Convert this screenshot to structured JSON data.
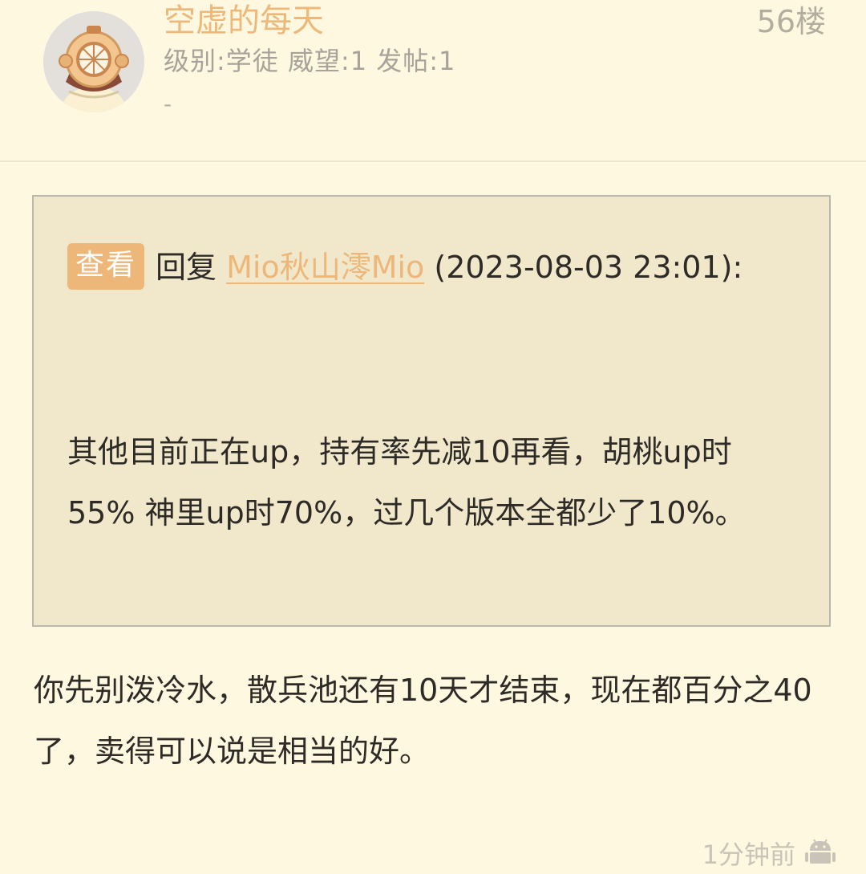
{
  "author": {
    "name": "空虚的每天",
    "meta": "级别:学徒 威望:1 发帖:1",
    "signature": "-",
    "avatar_icon": "diving-helmet-avatar"
  },
  "floor": "56楼",
  "quote": {
    "view_label": "查看",
    "reply_label": "回复",
    "quoted_user": "Mio秋山澪Mio",
    "timestamp": "(2023-08-03 23:01):",
    "text": "其他目前正在up，持有率先减10再看，胡桃up时55% 神里up时70%，过几个版本全都少了10%。"
  },
  "body": "你先别泼冷水，散兵池还有10天才结束，现在都百分之40了，卖得可以说是相当的好。",
  "footer": {
    "time": "1分钟前",
    "device_icon": "android-icon"
  },
  "colors": {
    "background": "#fef8e1",
    "accent": "#edb77a",
    "quote_background": "#f1e8cc",
    "text": "#2e2b27"
  }
}
